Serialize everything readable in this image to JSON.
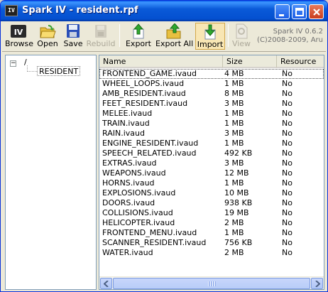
{
  "window": {
    "title": "Spark IV - resident.rpf",
    "icon_text": "IV",
    "buttons": [
      "minimize-icon",
      "maximize-icon",
      "close-icon"
    ]
  },
  "toolbar": {
    "browse_label": "Browse",
    "open_label": "Open",
    "save_label": "Save",
    "rebuild_label": "Rebuild",
    "export_label": "Export",
    "export_all_label": "Export All",
    "import_label": "Import",
    "view_label": "View",
    "version_line1": "Spark IV 0.6.2",
    "version_line2": "(C)2008-2009, Aru"
  },
  "tree": {
    "root_label": "/",
    "expander": "−",
    "child_label": "RESIDENT"
  },
  "file_list": {
    "columns": [
      "Name",
      "Size",
      "Resource"
    ],
    "rows": [
      {
        "name": "FRONTEND_GAME.ivaud",
        "size": "4 MB",
        "resource": "No"
      },
      {
        "name": "WHEEL_LOOPS.ivaud",
        "size": "1 MB",
        "resource": "No"
      },
      {
        "name": "AMB_RESIDENT.ivaud",
        "size": "8 MB",
        "resource": "No"
      },
      {
        "name": "FEET_RESIDENT.ivaud",
        "size": "3 MB",
        "resource": "No"
      },
      {
        "name": "MELEE.ivaud",
        "size": "1 MB",
        "resource": "No"
      },
      {
        "name": "TRAIN.ivaud",
        "size": "1 MB",
        "resource": "No"
      },
      {
        "name": "RAIN.ivaud",
        "size": "3 MB",
        "resource": "No"
      },
      {
        "name": "ENGINE_RESIDENT.ivaud",
        "size": "1 MB",
        "resource": "No"
      },
      {
        "name": "SPEECH_RELATED.ivaud",
        "size": "492 KB",
        "resource": "No"
      },
      {
        "name": "EXTRAS.ivaud",
        "size": "3 MB",
        "resource": "No"
      },
      {
        "name": "WEAPONS.ivaud",
        "size": "12 MB",
        "resource": "No"
      },
      {
        "name": "HORNS.ivaud",
        "size": "1 MB",
        "resource": "No"
      },
      {
        "name": "EXPLOSIONS.ivaud",
        "size": "10 MB",
        "resource": "No"
      },
      {
        "name": "DOORS.ivaud",
        "size": "938 KB",
        "resource": "No"
      },
      {
        "name": "COLLISIONS.ivaud",
        "size": "19 MB",
        "resource": "No"
      },
      {
        "name": "HELICOPTER.ivaud",
        "size": "2 MB",
        "resource": "No"
      },
      {
        "name": "FRONTEND_MENU.ivaud",
        "size": "1 MB",
        "resource": "No"
      },
      {
        "name": "SCANNER_RESIDENT.ivaud",
        "size": "756 KB",
        "resource": "No"
      },
      {
        "name": "WATER.ivaud",
        "size": "2 MB",
        "resource": "No"
      }
    ]
  },
  "colors": {
    "titlebar": "#0a5ad8",
    "selection_pressed": "#f8e6b4",
    "panel_border": "#7f9db9"
  }
}
